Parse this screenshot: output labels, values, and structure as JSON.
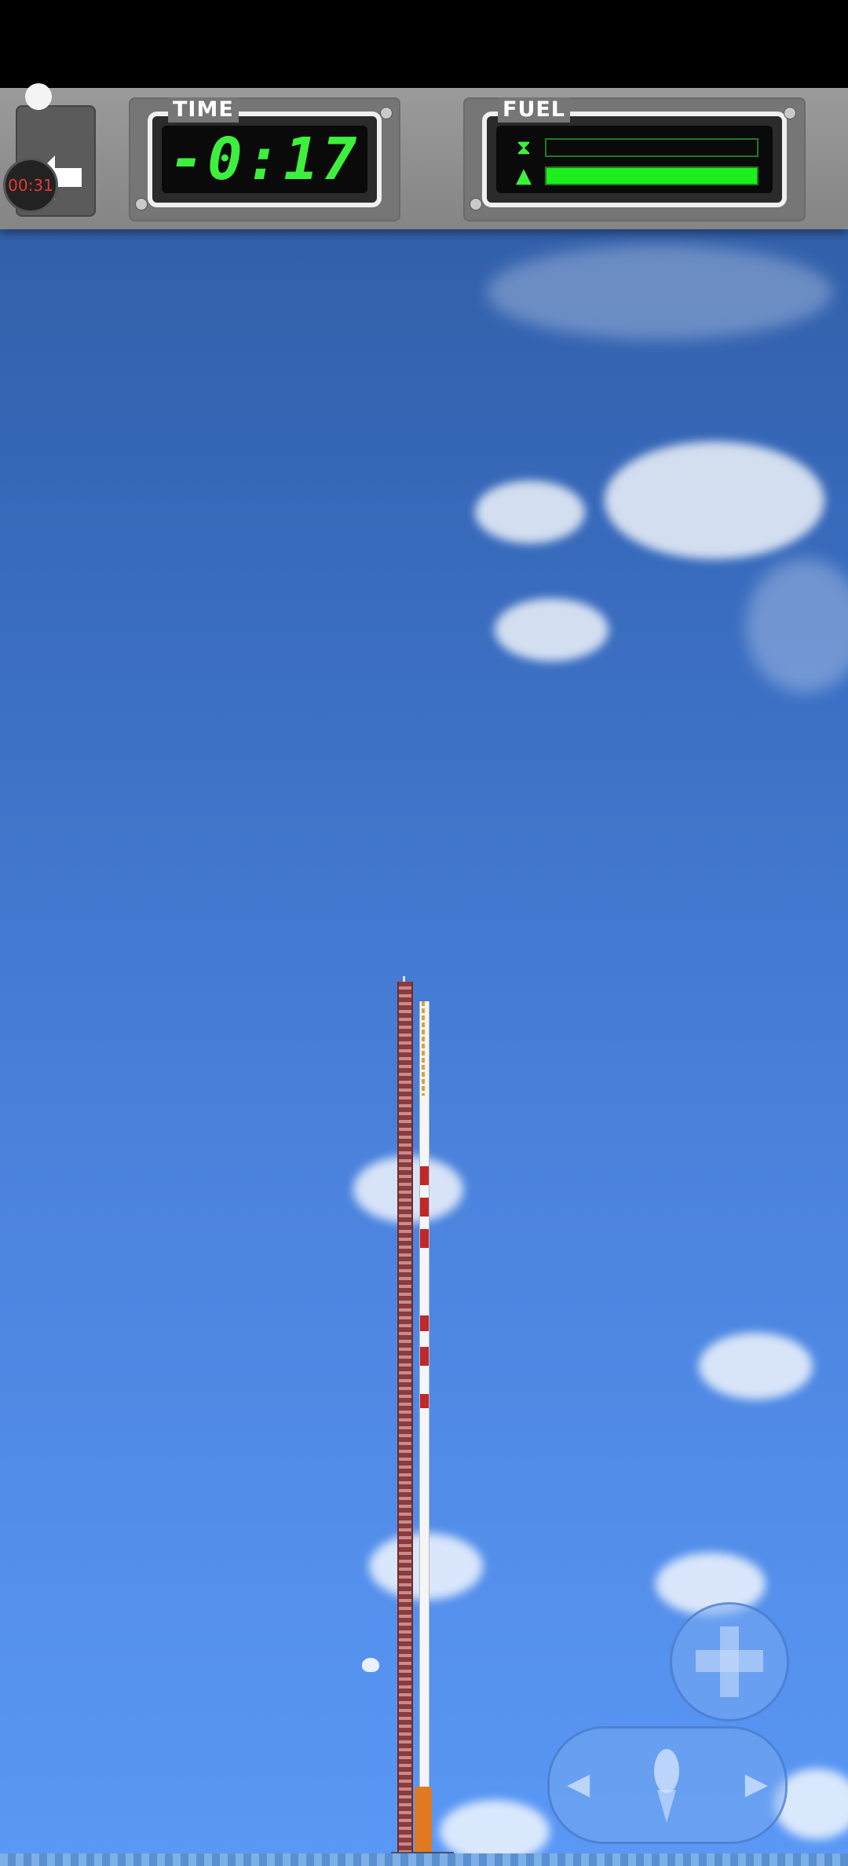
{
  "hud": {
    "time_title": "TIME",
    "time_value": "-0:17",
    "fuel_title": "FUEL",
    "fuel": {
      "stage_level": 0.0,
      "main_level": 1.0,
      "stage_icon": "hourglass-icon",
      "main_icon": "capsule-icon"
    }
  },
  "recording": {
    "elapsed": "00:31"
  },
  "colors": {
    "lcd_green": "#3df03d",
    "fuel_fill": "#1eee1e",
    "sky_top": "#2f5ba3",
    "sky_bottom": "#5a98f6",
    "timer_text": "#e53935"
  }
}
